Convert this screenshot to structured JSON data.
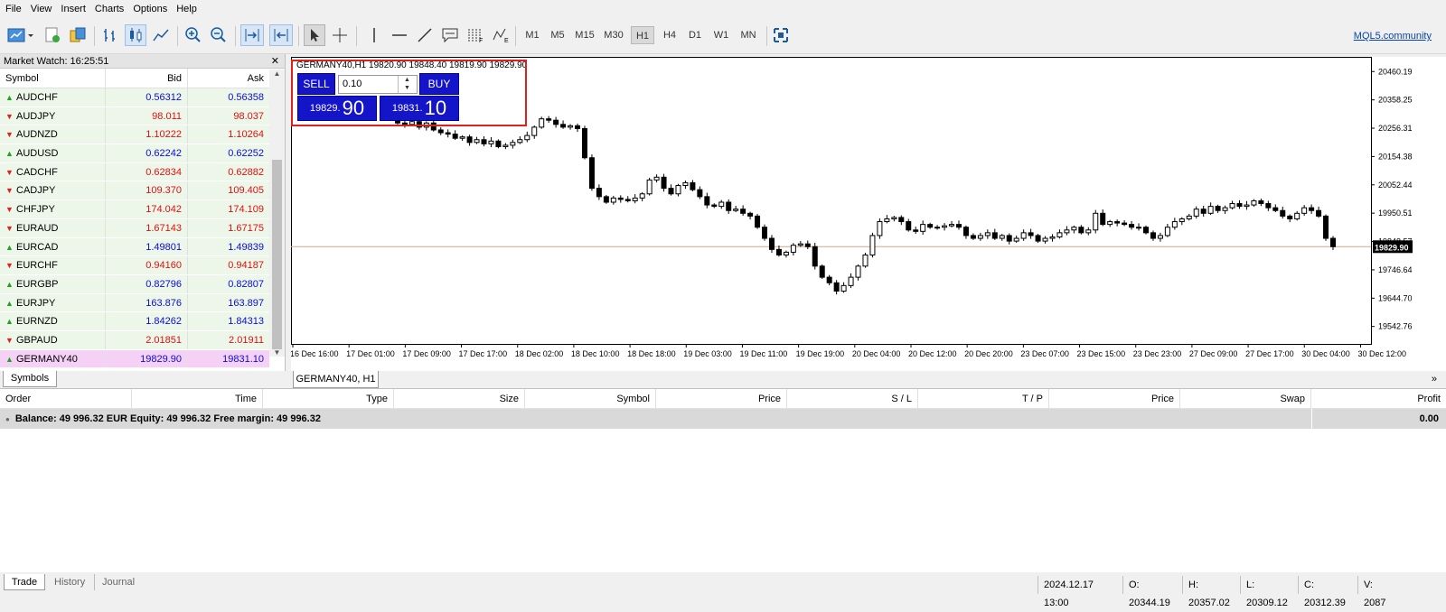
{
  "menu": [
    "File",
    "View",
    "Insert",
    "Charts",
    "Options",
    "Help"
  ],
  "timeframes": [
    "M1",
    "M5",
    "M15",
    "M30",
    "H1",
    "H4",
    "D1",
    "W1",
    "MN"
  ],
  "selected_timeframe": "H1",
  "community_link": "MQL5.community",
  "market_watch": {
    "title": "Market Watch: 16:25:51",
    "columns": {
      "symbol": "Symbol",
      "bid": "Bid",
      "ask": "Ask"
    },
    "rows": [
      {
        "symbol": "AUDCHF",
        "bid": "0.56312",
        "ask": "0.56358",
        "dir": "up"
      },
      {
        "symbol": "AUDJPY",
        "bid": "98.011",
        "ask": "98.037",
        "dir": "down"
      },
      {
        "symbol": "AUDNZD",
        "bid": "1.10222",
        "ask": "1.10264",
        "dir": "down"
      },
      {
        "symbol": "AUDUSD",
        "bid": "0.62242",
        "ask": "0.62252",
        "dir": "up"
      },
      {
        "symbol": "CADCHF",
        "bid": "0.62834",
        "ask": "0.62882",
        "dir": "down"
      },
      {
        "symbol": "CADJPY",
        "bid": "109.370",
        "ask": "109.405",
        "dir": "down"
      },
      {
        "symbol": "CHFJPY",
        "bid": "174.042",
        "ask": "174.109",
        "dir": "down"
      },
      {
        "symbol": "EURAUD",
        "bid": "1.67143",
        "ask": "1.67175",
        "dir": "down"
      },
      {
        "symbol": "EURCAD",
        "bid": "1.49801",
        "ask": "1.49839",
        "dir": "up"
      },
      {
        "symbol": "EURCHF",
        "bid": "0.94160",
        "ask": "0.94187",
        "dir": "down"
      },
      {
        "symbol": "EURGBP",
        "bid": "0.82796",
        "ask": "0.82807",
        "dir": "up"
      },
      {
        "symbol": "EURJPY",
        "bid": "163.876",
        "ask": "163.897",
        "dir": "up"
      },
      {
        "symbol": "EURNZD",
        "bid": "1.84262",
        "ask": "1.84313",
        "dir": "up"
      },
      {
        "symbol": "GBPAUD",
        "bid": "2.01851",
        "ask": "2.01911",
        "dir": "down"
      },
      {
        "symbol": "GERMANY40",
        "bid": "19829.90",
        "ask": "19831.10",
        "dir": "up"
      }
    ],
    "tab": "Symbols"
  },
  "chart": {
    "header": "GERMANY40,H1  19820.90 19848.40 19819.90 19829.90",
    "tab": "GERMANY40, H1",
    "current_price_label": "19829.90",
    "one_click": {
      "sell": "SELL",
      "buy": "BUY",
      "volume": "0.10",
      "sell_small": "19829.",
      "sell_big": "90",
      "buy_small": "19831.",
      "buy_big": "10"
    }
  },
  "chart_data": {
    "type": "candlestick",
    "y_ticks": [
      "20460.19",
      "20358.25",
      "20256.31",
      "20154.38",
      "20052.44",
      "19950.51",
      "19848.57",
      "19746.64",
      "19644.70",
      "19542.76"
    ],
    "x_ticks": [
      "16 Dec 16:00",
      "17 Dec 01:00",
      "17 Dec 09:00",
      "17 Dec 17:00",
      "18 Dec 02:00",
      "18 Dec 10:00",
      "18 Dec 18:00",
      "19 Dec 03:00",
      "19 Dec 11:00",
      "19 Dec 19:00",
      "20 Dec 04:00",
      "20 Dec 12:00",
      "20 Dec 20:00",
      "23 Dec 07:00",
      "23 Dec 15:00",
      "23 Dec 23:00",
      "27 Dec 09:00",
      "27 Dec 17:00",
      "30 Dec 04:00",
      "30 Dec 12:00"
    ],
    "ylim": [
      19480,
      20500
    ],
    "close_path": [
      20290,
      20275,
      20270,
      20280,
      20260,
      20275,
      20250,
      20240,
      20235,
      20220,
      20225,
      20205,
      20215,
      20200,
      20210,
      20190,
      20195,
      20205,
      20215,
      20230,
      20260,
      20290,
      20285,
      20270,
      20260,
      20265,
      20255,
      20150,
      20040,
      20010,
      19990,
      20005,
      20000,
      19995,
      20005,
      20020,
      20070,
      20080,
      20040,
      20020,
      20050,
      20060,
      20035,
      20010,
      19980,
      19975,
      19990,
      19960,
      19965,
      19950,
      19940,
      19900,
      19860,
      19820,
      19800,
      19810,
      19835,
      19840,
      19830,
      19760,
      19720,
      19700,
      19670,
      19690,
      19720,
      19760,
      19800,
      19870,
      19920,
      19930,
      19935,
      19920,
      19890,
      19885,
      19910,
      19900,
      19900,
      19905,
      19910,
      19900,
      19870,
      19860,
      19870,
      19880,
      19860,
      19870,
      19850,
      19860,
      19880,
      19870,
      19850,
      19860,
      19865,
      19880,
      19890,
      19900,
      19880,
      19890,
      19950,
      19910,
      19920,
      19915,
      19910,
      19900,
      19900,
      19880,
      19860,
      19870,
      19900,
      19920,
      19930,
      19940,
      19965,
      19950,
      19975,
      19960,
      19970,
      19985,
      19975,
      19980,
      19995,
      19985,
      19970,
      19960,
      19940,
      19930,
      19950,
      19970,
      19960,
      19940,
      19860,
      19829.9
    ],
    "current_price": 19829.9
  },
  "orders": {
    "columns": [
      "Order",
      "Time",
      "Type",
      "Size",
      "Symbol",
      "Price",
      "S / L",
      "T / P",
      "Price",
      "Swap",
      "Profit"
    ],
    "balance_line": "Balance: 49 996.32 EUR  Equity: 49 996.32  Free margin: 49 996.32",
    "profit_total": "0.00"
  },
  "bottom_tabs": [
    "Trade",
    "History",
    "Journal"
  ],
  "status": {
    "time": "2024.12.17 13:00",
    "open": "O: 20344.19",
    "high": "H: 20357.02",
    "low": "L: 20309.12",
    "close": "C: 20312.39",
    "volume": "V: 2087"
  },
  "colors": {
    "sell_buy_bg": "#1414c8",
    "oct_border": "#e01f1f",
    "bid_blue": "#0b0bdc",
    "bid_red": "#e01010",
    "highlight_row": "#f6d1f6"
  }
}
